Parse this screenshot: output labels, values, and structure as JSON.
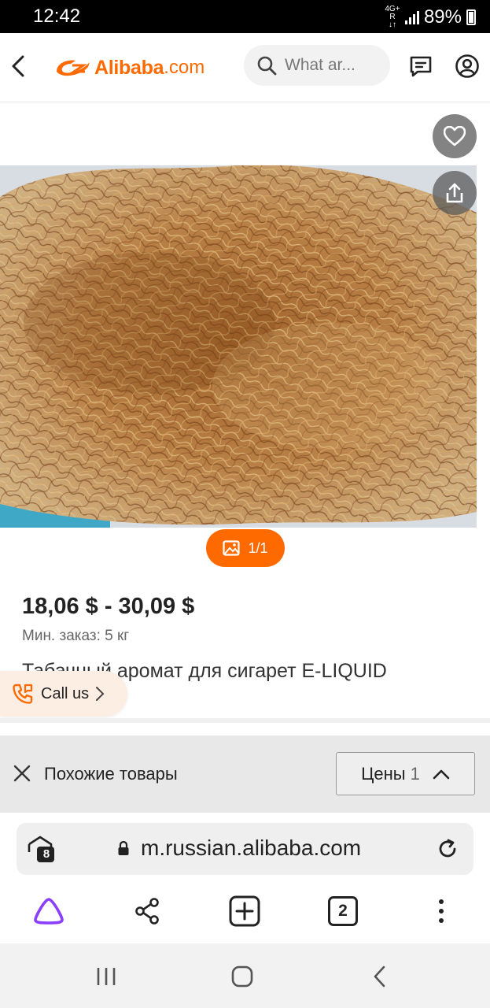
{
  "status_bar": {
    "time": "12:42",
    "network_top": "4G+ R",
    "network_bottom": "↓↑",
    "battery": "89%"
  },
  "header": {
    "logo_text": "Alibaba",
    "logo_domain": ".com",
    "search_placeholder": "What ar...",
    "icons": [
      "back-arrow-icon",
      "search-icon",
      "messages-icon",
      "account-icon"
    ]
  },
  "gallery": {
    "image_counter": "1/1",
    "icons": [
      "favorite-heart-icon",
      "share-icon",
      "gallery-image-icon"
    ]
  },
  "product": {
    "price": "18,06 $ - 30,09 $",
    "min_order": "Мин. заказ: 5 кг",
    "title": "Табачный аромат для сигарет E-LIQUID"
  },
  "call_us": {
    "label": "Call us"
  },
  "similar_bar": {
    "label": "Похожие товары",
    "prices_label": "Цены",
    "prices_count": "1"
  },
  "browser": {
    "tab_badge": "8",
    "url": "m.russian.alibaba.com",
    "open_tabs": "2"
  },
  "colors": {
    "brand": "#ff6a00",
    "alice": "#8a3ffc"
  }
}
